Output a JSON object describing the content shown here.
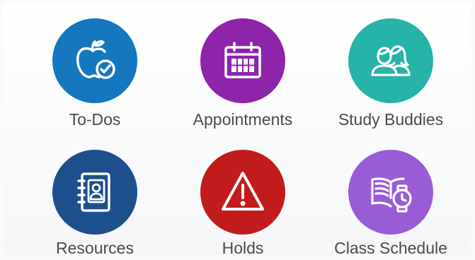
{
  "tiles": [
    {
      "label": "To-Dos",
      "color": "#1577be",
      "icon": "apple-check-icon"
    },
    {
      "label": "Appointments",
      "color": "#8e24aa",
      "icon": "calendar-icon"
    },
    {
      "label": "Study Buddies",
      "color": "#26b3a9",
      "icon": "people-icon"
    },
    {
      "label": "Resources",
      "color": "#1c4f8c",
      "icon": "address-book-icon"
    },
    {
      "label": "Holds",
      "color": "#c21b1b",
      "icon": "warning-icon"
    },
    {
      "label": "Class Schedule",
      "color": "#9a5bd6",
      "icon": "book-watch-icon"
    }
  ]
}
